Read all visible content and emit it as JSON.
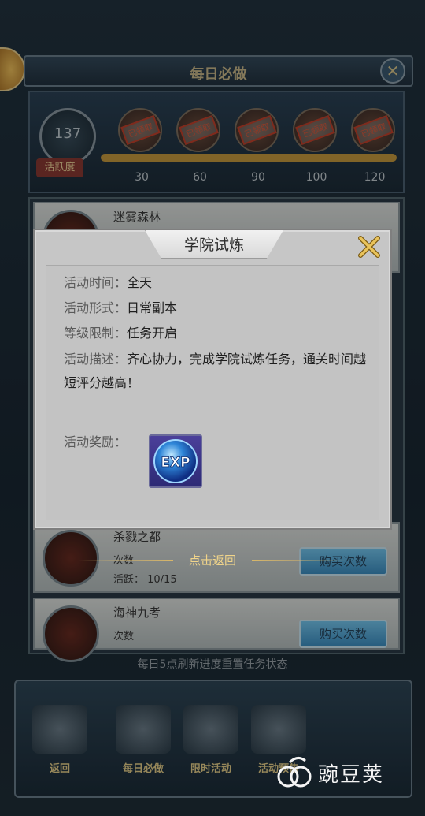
{
  "background": {
    "panel_title": "每日必做",
    "activity_value": "137",
    "activity_label": "活跃度",
    "chest_stamp": "已领取",
    "milestones": [
      "30",
      "60",
      "90",
      "100",
      "120"
    ],
    "rows": [
      {
        "title": "迷雾森林"
      },
      {
        "title": "杀戮之都",
        "line1": "次数",
        "line2": "活跃： 10/15",
        "button": "购买次数"
      },
      {
        "title": "海神九考",
        "line1": "次数",
        "button": "购买次数"
      }
    ],
    "refresh_hint": "每日5点刷新进度重置任务状态",
    "nav": [
      "返回",
      "每日必做",
      "限时活动",
      "活动预告"
    ]
  },
  "dialog": {
    "title": "学院试炼",
    "time_key": "活动时间：",
    "time_val": "全天",
    "form_key": "活动形式：",
    "form_val": "日常副本",
    "level_key": "等级限制：",
    "level_val": "任务开启",
    "desc_key": "活动描述：",
    "desc_val": "齐心协力，完成学院试炼任务，通关时间越短评分越高！",
    "reward_key": "活动奖励：",
    "reward_icon": "exp-icon",
    "reward_icon_text": "EXP"
  },
  "back_hint": "点击返回",
  "watermark": "豌豆荚"
}
